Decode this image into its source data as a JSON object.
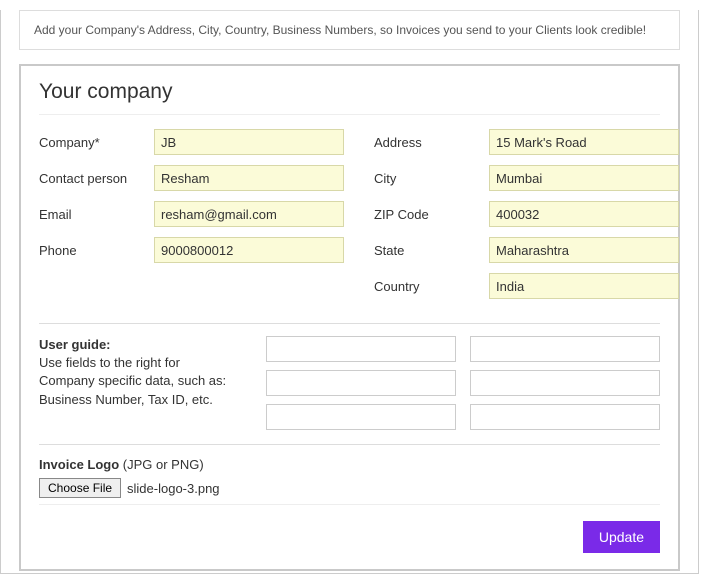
{
  "info": {
    "text": "Add your Company's Address, City, Country, Business Numbers, so Invoices you send to your Clients look credible!"
  },
  "panel": {
    "title": "Your company"
  },
  "fields": {
    "left": {
      "company": {
        "label": "Company*",
        "value": "JB"
      },
      "contactPerson": {
        "label": "Contact person",
        "value": "Resham"
      },
      "email": {
        "label": "Email",
        "value": "resham@gmail.com"
      },
      "phone": {
        "label": "Phone",
        "value": "9000800012"
      }
    },
    "right": {
      "address": {
        "label": "Address",
        "value": "15 Mark's Road"
      },
      "city": {
        "label": "City",
        "value": "Mumbai"
      },
      "zip": {
        "label": "ZIP Code",
        "value": "400032"
      },
      "state": {
        "label": "State",
        "value": "Maharashtra"
      },
      "country": {
        "label": "Country",
        "value": "India"
      }
    }
  },
  "userGuide": {
    "title": "User guide:",
    "text": "Use fields to the right for Company specific data, such as: Business Number, Tax ID, etc."
  },
  "extraFields": {
    "r1a": "",
    "r1b": "",
    "r2a": "",
    "r2b": "",
    "r3a": "",
    "r3b": ""
  },
  "logo": {
    "labelBold": "Invoice Logo",
    "labelRest": " (JPG or PNG)",
    "buttonLabel": "Choose File",
    "fileName": "slide-logo-3.png"
  },
  "actions": {
    "update": "Update"
  }
}
